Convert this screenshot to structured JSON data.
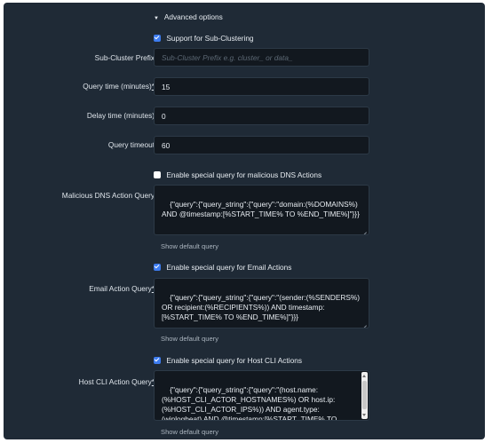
{
  "advanced": {
    "toggle_label": "Advanced options"
  },
  "subcluster_support": {
    "label": "Support for Sub-Clustering",
    "checked": true
  },
  "subcluster_prefix": {
    "label": "Sub-Cluster Prefix",
    "placeholder": "Sub-Cluster Prefix e.g. cluster_ or data_"
  },
  "query_time": {
    "label": "Query time (minutes)",
    "required_mark": "*",
    "value": "15"
  },
  "delay_time": {
    "label": "Delay time (minutes)",
    "value": "0"
  },
  "query_timeout": {
    "label": "Query timeout",
    "value": "60"
  },
  "dns": {
    "checkbox_label": "Enable special query for malicious DNS Actions",
    "checked": false,
    "label": "Malicious DNS Action Query",
    "value": "{\"query\":{\"query_string\":{\"query\":\"domain:(%DOMAINS%) AND @timestamp:[%START_TIME% TO %END_TIME%]\"}}}",
    "show_default": "Show default query"
  },
  "email": {
    "checkbox_label": "Enable special query for Email Actions",
    "checked": true,
    "label": "Email Action Query",
    "required_mark": "*",
    "value": "{\"query\":{\"query_string\":{\"query\":\"(sender:(%SENDERS%) OR recipient:(%RECIPIENTS%)) AND timestamp:[%START_TIME% TO %END_TIME%]\"}}}",
    "show_default": "Show default query"
  },
  "hostcli": {
    "checkbox_label": "Enable special query for Host CLI Actions",
    "checked": true,
    "label": "Host CLI Action Query",
    "required_mark": "*",
    "value": "{\"query\":{\"query_string\":{\"query\":\"(host.name:(%HOST_CLI_ACTOR_HOSTNAMES%) OR host.ip:(%HOST_CLI_ACTOR_IPS%)) AND agent.type:(winlogbeat) AND @timestamp:[%START_TIME% TO %END_TIME%]\"}},\"sort\":{\"@timestamp\":{\"order\":",
    "show_default": "Show default query"
  },
  "colors": {
    "panel": "#1f2a36",
    "field": "#12181f",
    "accent": "#3d7cf0"
  }
}
